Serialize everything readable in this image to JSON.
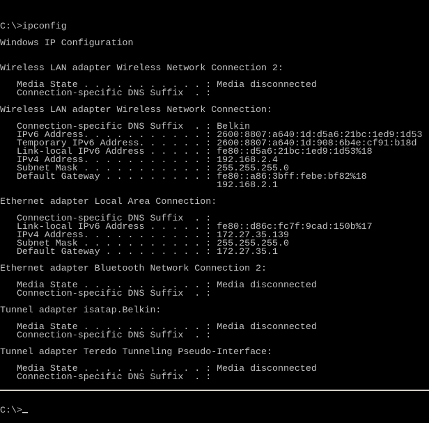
{
  "console": {
    "lines": [
      "C:\\>ipconfig",
      "",
      "Windows IP Configuration",
      "",
      "",
      "Wireless LAN adapter Wireless Network Connection 2:",
      "",
      "   Media State . . . . . . . . . . . : Media disconnected",
      "   Connection-specific DNS Suffix  . :",
      "",
      "Wireless LAN adapter Wireless Network Connection:",
      "",
      "   Connection-specific DNS Suffix  . : Belkin",
      "   IPv6 Address. . . . . . . . . . . : 2600:8807:a640:1d:d5a6:21bc:1ed9:1d53",
      "   Temporary IPv6 Address. . . . . . : 2600:8807:a640:1d:908:6b4e:cf91:b18d",
      "   Link-local IPv6 Address . . . . . : fe80::d5a6:21bc:1ed9:1d53%18",
      "   IPv4 Address. . . . . . . . . . . : 192.168.2.4",
      "   Subnet Mask . . . . . . . . . . . : 255.255.255.0",
      "   Default Gateway . . . . . . . . . : fe80::a86:3bff:febe:bf82%18",
      "                                       192.168.2.1",
      "",
      "Ethernet adapter Local Area Connection:",
      "",
      "   Connection-specific DNS Suffix  . :",
      "   Link-local IPv6 Address . . . . . : fe80::d86c:fc7f:9cad:150b%17",
      "   IPv4 Address. . . . . . . . . . . : 172.27.35.139",
      "   Subnet Mask . . . . . . . . . . . : 255.255.255.0",
      "   Default Gateway . . . . . . . . . : 172.27.35.1",
      "",
      "Ethernet adapter Bluetooth Network Connection 2:",
      "",
      "   Media State . . . . . . . . . . . : Media disconnected",
      "   Connection-specific DNS Suffix  . :",
      "",
      "Tunnel adapter isatap.Belkin:",
      "",
      "   Media State . . . . . . . . . . . : Media disconnected",
      "   Connection-specific DNS Suffix  . :",
      "",
      "Tunnel adapter Teredo Tunneling Pseudo-Interface:",
      "",
      "   Media State . . . . . . . . . . . : Media disconnected",
      "   Connection-specific DNS Suffix  . :",
      ""
    ],
    "prompt": "C:\\>"
  },
  "colors": {
    "background": "#000000",
    "foreground": "#c0c0c0"
  }
}
